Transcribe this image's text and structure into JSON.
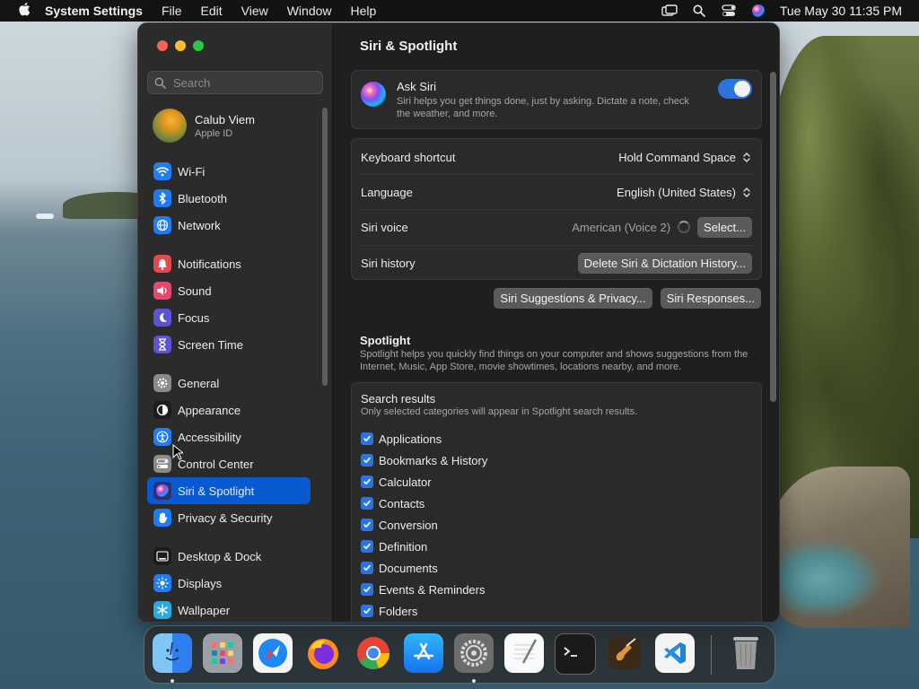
{
  "menubar": {
    "app_name": "System Settings",
    "menus": [
      "File",
      "Edit",
      "View",
      "Window",
      "Help"
    ],
    "clock": "Tue May 30  11:35 PM"
  },
  "window": {
    "search_placeholder": "Search",
    "profile": {
      "name": "Calub Viem",
      "sub": "Apple ID"
    },
    "sidebar_items": [
      {
        "label": "Wi-Fi",
        "icon": "wifi-icon",
        "color": "#1f7cf5"
      },
      {
        "label": "Bluetooth",
        "icon": "bluetooth-icon",
        "color": "#1f7cf5"
      },
      {
        "label": "Network",
        "icon": "globe-icon",
        "color": "#1f7cf5"
      },
      {
        "label": "Notifications",
        "icon": "bell-icon",
        "color": "#e5484d"
      },
      {
        "label": "Sound",
        "icon": "speaker-icon",
        "color": "#e5486a"
      },
      {
        "label": "Focus",
        "icon": "moon-icon",
        "color": "#5b52d6"
      },
      {
        "label": "Screen Time",
        "icon": "hourglass-icon",
        "color": "#5b52d6"
      },
      {
        "label": "General",
        "icon": "gear-icon",
        "color": "#8a8a8a"
      },
      {
        "label": "Appearance",
        "icon": "appearance-icon",
        "color": "#1c1c1c"
      },
      {
        "label": "Accessibility",
        "icon": "accessibility-icon",
        "color": "#1f7cf5"
      },
      {
        "label": "Control Center",
        "icon": "control-center-icon",
        "color": "#8a8a8a"
      },
      {
        "label": "Siri & Spotlight",
        "icon": "siri-icon",
        "color": "#3a2b6b"
      },
      {
        "label": "Privacy & Security",
        "icon": "hand-icon",
        "color": "#1f7cf5"
      },
      {
        "label": "Desktop & Dock",
        "icon": "dock-icon",
        "color": "#1c1c1c"
      },
      {
        "label": "Displays",
        "icon": "sun-icon",
        "color": "#1f7cf5"
      },
      {
        "label": "Wallpaper",
        "icon": "snowflake-icon",
        "color": "#2ca8e0"
      }
    ],
    "selected_item": "Siri & Spotlight"
  },
  "content": {
    "title": "Siri & Spotlight",
    "ask_siri": {
      "title": "Ask Siri",
      "desc": "Siri helps you get things done, just by asking. Dictate a note, check the weather, and more.",
      "enabled": true
    },
    "rows": {
      "shortcut": {
        "label": "Keyboard shortcut",
        "value": "Hold Command Space"
      },
      "language": {
        "label": "Language",
        "value": "English (United States)"
      },
      "voice": {
        "label": "Siri voice",
        "value": "American (Voice 2)",
        "button": "Select..."
      },
      "history": {
        "label": "Siri history",
        "button": "Delete Siri & Dictation History..."
      }
    },
    "links": {
      "suggestions": "Siri Suggestions & Privacy...",
      "responses": "Siri Responses..."
    },
    "spotlight": {
      "title": "Spotlight",
      "desc": "Spotlight helps you quickly find things on your computer and shows suggestions from the Internet, Music, App Store, movie showtimes, locations nearby, and more."
    },
    "search_results": {
      "title": "Search results",
      "sub": "Only selected categories will appear in Spotlight search results.",
      "categories": [
        "Applications",
        "Bookmarks & History",
        "Calculator",
        "Contacts",
        "Conversion",
        "Definition",
        "Documents",
        "Events & Reminders",
        "Folders"
      ]
    }
  },
  "dock": {
    "apps": [
      "finder-icon",
      "launchpad-icon",
      "safari-icon",
      "firefox-icon",
      "chrome-icon",
      "app-store-icon",
      "system-settings-icon",
      "textedit-icon",
      "terminal-icon",
      "garageband-icon",
      "vscode-icon",
      "trash-icon"
    ]
  }
}
